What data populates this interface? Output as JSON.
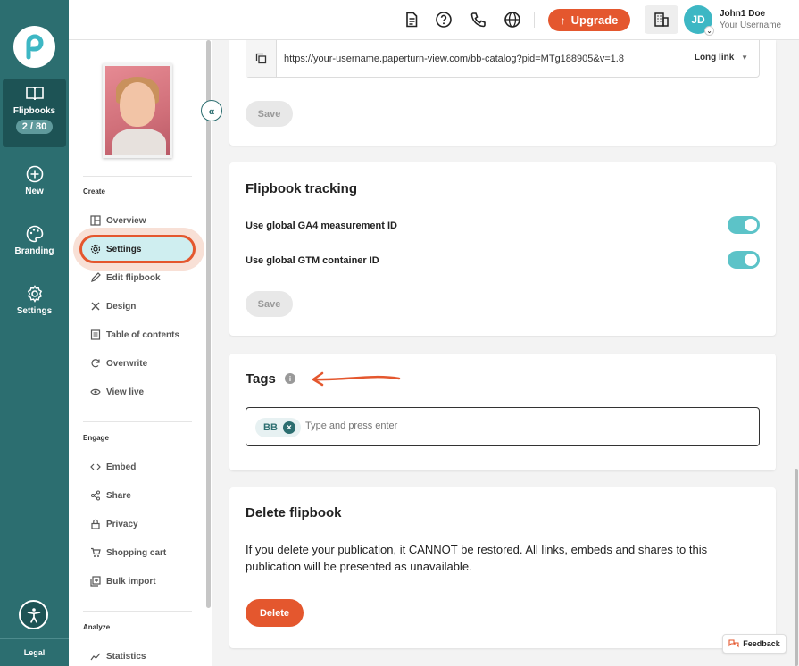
{
  "rail": {
    "flipbooks_label": "Flipbooks",
    "flipbooks_count": "2 / 80",
    "new_label": "New",
    "branding_label": "Branding",
    "settings_label": "Settings",
    "legal_label": "Legal"
  },
  "topbar": {
    "upgrade_label": "Upgrade",
    "avatar_initials": "JD",
    "user_name": "John1 Doe",
    "user_sub": "Your Username"
  },
  "sidebar": {
    "create_title": "Create",
    "create_items": [
      "Overview",
      "Settings",
      "Edit flipbook",
      "Design",
      "Table of contents",
      "Overwrite",
      "View live"
    ],
    "engage_title": "Engage",
    "engage_items": [
      "Embed",
      "Share",
      "Privacy",
      "Shopping cart",
      "Bulk import"
    ],
    "analyze_title": "Analyze",
    "analyze_items": [
      "Statistics"
    ],
    "collapse_glyph": "«"
  },
  "link_card": {
    "url": "https://your-username.paperturn-view.com/bb-catalog?pid=MTg188905&v=1.8",
    "link_type": "Long link",
    "save_label": "Save"
  },
  "tracking_card": {
    "title": "Flipbook tracking",
    "ga4_label": "Use global GA4 measurement ID",
    "gtm_label": "Use global GTM container ID",
    "save_label": "Save"
  },
  "tags_card": {
    "title": "Tags",
    "chip_label": "BB",
    "input_placeholder": "Type and press enter"
  },
  "delete_card": {
    "title": "Delete flipbook",
    "text": "If you delete your publication, it CANNOT be restored. All links, embeds and shares to this publication will be presented as unavailable.",
    "delete_label": "Delete"
  },
  "feedback_label": "Feedback",
  "colors": {
    "rail": "#2c6e70",
    "accent": "#e4572e",
    "toggle": "#5cc3c8"
  }
}
